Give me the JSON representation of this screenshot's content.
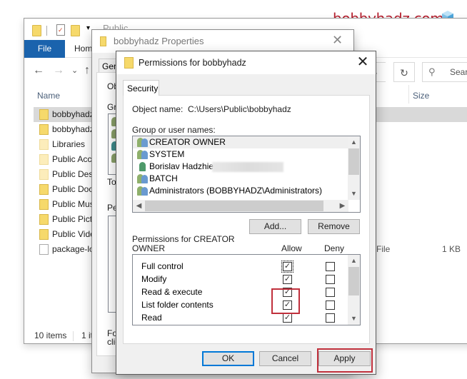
{
  "watermark": {
    "text": "bobbyhadz.com",
    "icon": "cube-icon",
    "color": "#b5202f"
  },
  "explorer": {
    "title": "Public",
    "ribbon_tabs": [
      {
        "label": "File",
        "active": true
      },
      {
        "label": "Home"
      }
    ],
    "nav": {
      "back": "←",
      "forward": "→",
      "recent": "⌄",
      "up": "↑",
      "refresh": "↻",
      "address_dropdown": "⌄"
    },
    "search": {
      "placeholder": "Search"
    },
    "columns": {
      "name": "Name",
      "size": "Size"
    },
    "items": [
      {
        "name": "bobbyhadz",
        "type": "",
        "size": "",
        "icon": "folder-icon",
        "selected": true
      },
      {
        "name": "bobbyhadz",
        "type": "",
        "size": "",
        "icon": "folder-icon"
      },
      {
        "name": "Libraries",
        "type": "",
        "size": "",
        "icon": "folder-icon-pale"
      },
      {
        "name": "Public Acc",
        "type": "",
        "size": "",
        "icon": "folder-icon-pale"
      },
      {
        "name": "Public Desl",
        "type": "",
        "size": "",
        "icon": "folder-icon-pale"
      },
      {
        "name": "Public Doc",
        "type": "",
        "size": "",
        "icon": "folder-icon"
      },
      {
        "name": "Public Mus",
        "type": "",
        "size": "",
        "icon": "folder-icon"
      },
      {
        "name": "Public Pict",
        "type": "",
        "size": "",
        "icon": "folder-icon"
      },
      {
        "name": "Public Vide",
        "type": "",
        "size": "",
        "icon": "folder-icon"
      },
      {
        "name": "package-lo",
        "type": "File",
        "size": "1 KB",
        "icon": "json-file-icon"
      }
    ],
    "status": {
      "count": "10 items",
      "selected": "1 it"
    }
  },
  "properties_dialog": {
    "title": "bobbyhadz Properties",
    "tab": "Gen",
    "labels": {
      "object": "Ob",
      "group": "Gr",
      "to": "To",
      "perm": "Pe",
      "footer1": "Fo",
      "footer2": "clic"
    }
  },
  "permissions_dialog": {
    "title": "Permissions for bobbyhadz",
    "tab": "Security",
    "object_name_label": "Object name:",
    "object_name_value": "C:\\Users\\Public\\bobbyhadz",
    "group_label": "Group or user names:",
    "users": [
      {
        "name": "CREATOR OWNER",
        "icon": "group-icon",
        "selected": true
      },
      {
        "name": "SYSTEM",
        "icon": "group-icon"
      },
      {
        "name": "Borislav Hadzhiev",
        "icon": "user-icon",
        "redacted": true
      },
      {
        "name": "BATCH",
        "icon": "group-icon"
      },
      {
        "name": "Administrators (BOBBYHADZ\\Administrators)",
        "icon": "group-icon"
      }
    ],
    "add_button": "Add...",
    "remove_button": "Remove",
    "permissions_label_line1": "Permissions for CREATOR",
    "permissions_label_line2": "OWNER",
    "allow_header": "Allow",
    "deny_header": "Deny",
    "permissions": [
      {
        "name": "Full control",
        "allow": true,
        "deny": false,
        "focused": true
      },
      {
        "name": "Modify",
        "allow": true,
        "deny": false
      },
      {
        "name": "Read & execute",
        "allow": true,
        "deny": false
      },
      {
        "name": "List folder contents",
        "allow": true,
        "deny": false
      },
      {
        "name": "Read",
        "allow": true,
        "deny": false
      }
    ],
    "ok_button": "OK",
    "cancel_button": "Cancel",
    "apply_button": "Apply",
    "close": "✕",
    "highlight_color": "#c0303c"
  }
}
